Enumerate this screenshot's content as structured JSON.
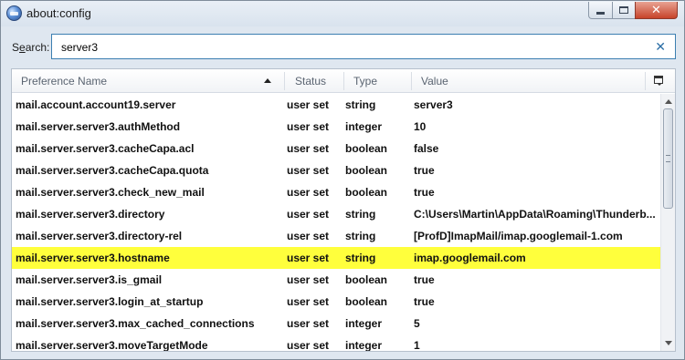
{
  "window": {
    "title": "about:config"
  },
  "search": {
    "label_prefix": "S",
    "label_accel": "e",
    "label_suffix": "arch:",
    "value": "server3"
  },
  "columns": {
    "name": "Preference Name",
    "status": "Status",
    "type": "Type",
    "value": "Value"
  },
  "rows": [
    {
      "name": "mail.account.account19.server",
      "status": "user set",
      "type": "string",
      "value": "server3"
    },
    {
      "name": "mail.server.server3.authMethod",
      "status": "user set",
      "type": "integer",
      "value": "10"
    },
    {
      "name": "mail.server.server3.cacheCapa.acl",
      "status": "user set",
      "type": "boolean",
      "value": "false"
    },
    {
      "name": "mail.server.server3.cacheCapa.quota",
      "status": "user set",
      "type": "boolean",
      "value": "true"
    },
    {
      "name": "mail.server.server3.check_new_mail",
      "status": "user set",
      "type": "boolean",
      "value": "true"
    },
    {
      "name": "mail.server.server3.directory",
      "status": "user set",
      "type": "string",
      "value": "C:\\Users\\Martin\\AppData\\Roaming\\Thunderb..."
    },
    {
      "name": "mail.server.server3.directory-rel",
      "status": "user set",
      "type": "string",
      "value": "[ProfD]ImapMail/imap.googlemail-1.com"
    },
    {
      "name": "mail.server.server3.hostname",
      "status": "user set",
      "type": "string",
      "value": "imap.googlemail.com"
    },
    {
      "name": "mail.server.server3.is_gmail",
      "status": "user set",
      "type": "boolean",
      "value": "true"
    },
    {
      "name": "mail.server.server3.login_at_startup",
      "status": "user set",
      "type": "boolean",
      "value": "true"
    },
    {
      "name": "mail.server.server3.max_cached_connections",
      "status": "user set",
      "type": "integer",
      "value": "5"
    },
    {
      "name": "mail.server.server3.moveTargetMode",
      "status": "user set",
      "type": "integer",
      "value": "1"
    }
  ],
  "selected_row_color": "#ffff3c",
  "icons": {
    "app": "thunderbird-icon",
    "clear": "clear-search-icon",
    "sort": "sort-ascending-icon",
    "column_picker": "column-picker-icon"
  }
}
